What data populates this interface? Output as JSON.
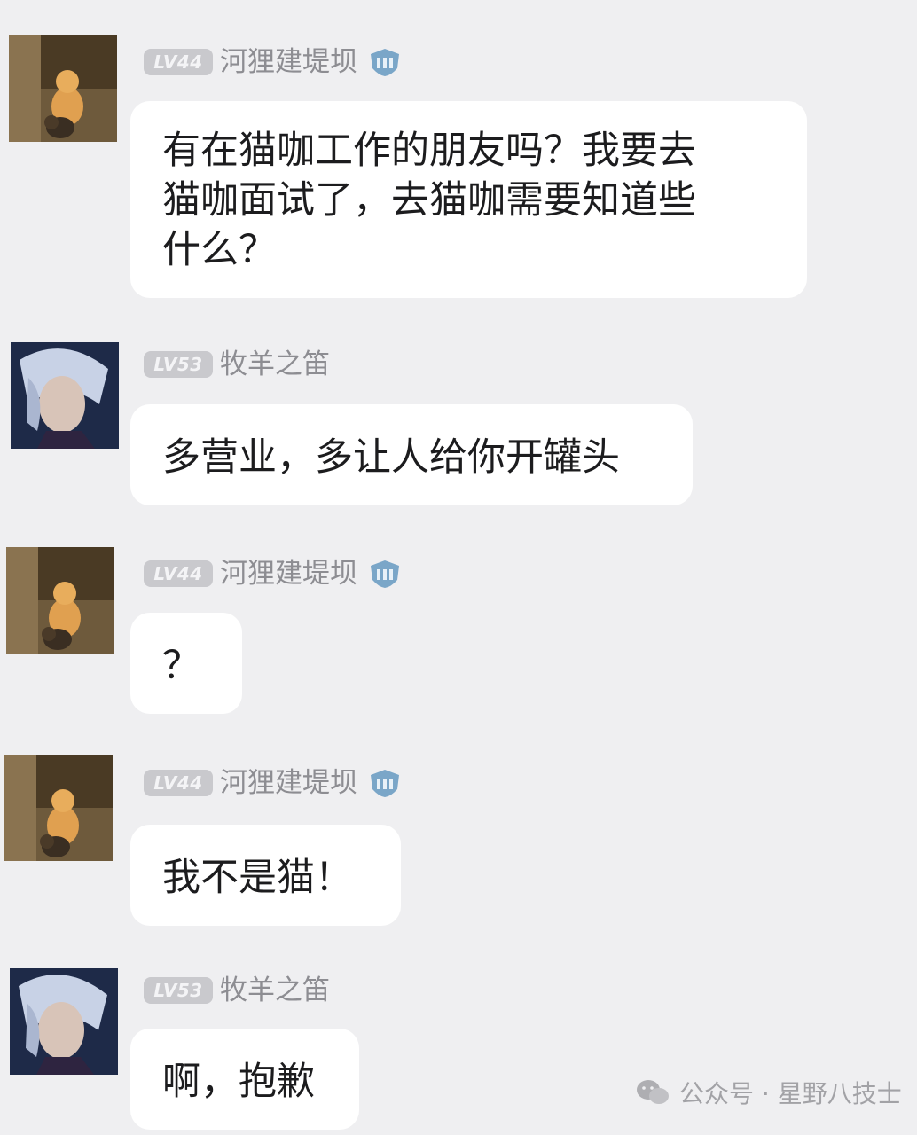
{
  "messages": [
    {
      "level": "LV44",
      "user": "河狸建堤坝",
      "avatar": "cat-photo-avatar",
      "badge": "shield-badge-icon",
      "text": "有在猫咖工作的朋友吗？我要去\n猫咖面试了，去猫咖需要知道些\n什么？"
    },
    {
      "level": "LV53",
      "user": "牧羊之笛",
      "avatar": "anime-character-avatar",
      "text": "多营业，多让人给你开罐头"
    },
    {
      "level": "LV44",
      "user": "河狸建堤坝",
      "avatar": "cat-photo-avatar",
      "badge": "shield-badge-icon",
      "text": "？"
    },
    {
      "level": "LV44",
      "user": "河狸建堤坝",
      "avatar": "cat-photo-avatar",
      "badge": "shield-badge-icon",
      "text": "我不是猫！"
    },
    {
      "level": "LV53",
      "user": "牧羊之笛",
      "avatar": "anime-character-avatar",
      "text": "啊，抱歉"
    }
  ],
  "watermark": {
    "icon": "wechat-icon",
    "text": "公众号 · 星野八技士"
  },
  "colors": {
    "background": "#efeff1",
    "bubble": "#ffffff",
    "level_badge": "#c9c9cd",
    "username": "#8d8d92",
    "text": "#1c1c1e"
  }
}
